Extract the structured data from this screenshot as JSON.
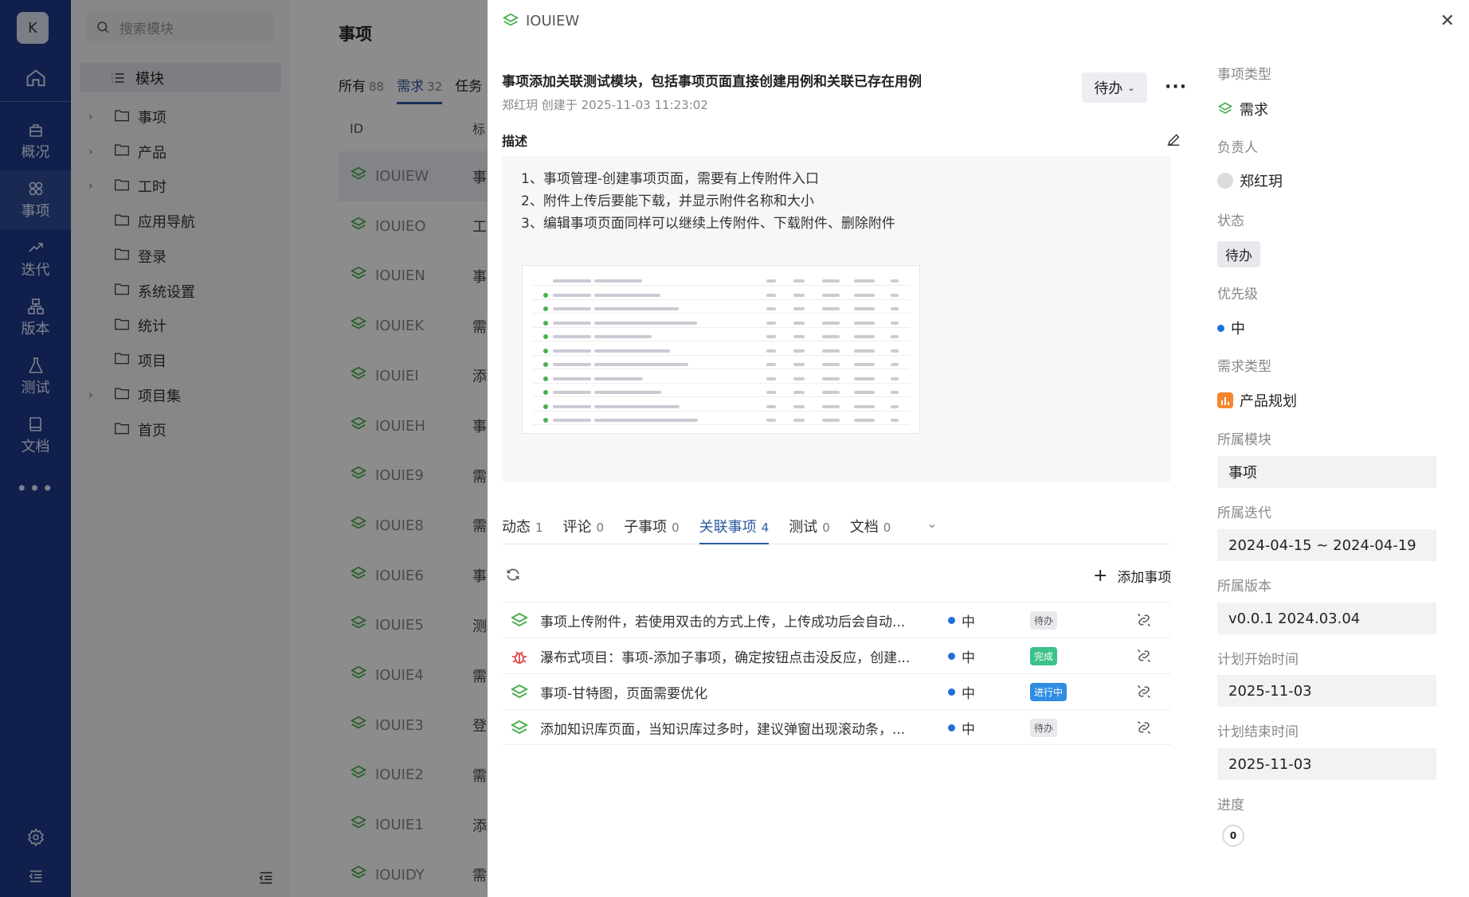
{
  "rail": {
    "avatar": "K",
    "items": [
      {
        "label": "概况",
        "icon": "overview-icon"
      },
      {
        "label": "事项",
        "icon": "workitem-icon"
      },
      {
        "label": "迭代",
        "icon": "sprint-icon"
      },
      {
        "label": "版本",
        "icon": "version-icon"
      },
      {
        "label": "测试",
        "icon": "test-icon"
      },
      {
        "label": "文档",
        "icon": "doc-icon"
      }
    ],
    "more": "•••"
  },
  "modules": {
    "search_placeholder": "搜索模块",
    "header": "模块",
    "tree": [
      {
        "label": "事项",
        "expandable": true
      },
      {
        "label": "产品",
        "expandable": true
      },
      {
        "label": "工时",
        "expandable": true
      },
      {
        "label": "应用导航",
        "expandable": false
      },
      {
        "label": "登录",
        "expandable": false
      },
      {
        "label": "系统设置",
        "expandable": false
      },
      {
        "label": "统计",
        "expandable": false
      },
      {
        "label": "项目",
        "expandable": false
      },
      {
        "label": "项目集",
        "expandable": true
      },
      {
        "label": "首页",
        "expandable": false
      }
    ]
  },
  "list": {
    "title": "事项",
    "tabs": [
      {
        "label": "所有",
        "count": "88"
      },
      {
        "label": "需求",
        "count": "32"
      },
      {
        "label": "任务",
        "count": ""
      }
    ],
    "columns": {
      "id": "ID",
      "title": "标"
    },
    "rows": [
      {
        "id": "IOUIEW",
        "t": "事"
      },
      {
        "id": "IOUIEO",
        "t": "工"
      },
      {
        "id": "IOUIEN",
        "t": "事"
      },
      {
        "id": "IOUIEK",
        "t": "需"
      },
      {
        "id": "IOUIEI",
        "t": "添"
      },
      {
        "id": "IOUIEH",
        "t": "事"
      },
      {
        "id": "IOUIE9",
        "t": "需"
      },
      {
        "id": "IOUIE8",
        "t": "需"
      },
      {
        "id": "IOUIE6",
        "t": "事"
      },
      {
        "id": "IOUIE5",
        "t": "测"
      },
      {
        "id": "IOUIE4",
        "t": "需"
      },
      {
        "id": "IOUIE3",
        "t": "登"
      },
      {
        "id": "IOUIE2",
        "t": "需"
      },
      {
        "id": "IOUIE1",
        "t": "添"
      },
      {
        "id": "IOUIDY",
        "t": "需"
      }
    ]
  },
  "drawer": {
    "item_id": "IOUIEW",
    "title": "事项添加关联测试模块，包括事项页面直接创建用例和关联已存在用例",
    "meta": "郑红玥 创建于 2025-11-03 11:23:02",
    "status": "待办",
    "description_label": "描述",
    "description_lines": [
      "1、事项管理-创建事项页面，需要有上传附件入口",
      "2、附件上传后要能下载，并显示附件名称和大小",
      "3、编辑事项页面同样可以继续上传附件、下载附件、删除附件"
    ],
    "tabs": [
      {
        "label": "动态",
        "count": "1"
      },
      {
        "label": "评论",
        "count": "0"
      },
      {
        "label": "子事项",
        "count": "0"
      },
      {
        "label": "关联事项",
        "count": "4"
      },
      {
        "label": "测试",
        "count": "0"
      },
      {
        "label": "文档",
        "count": "0"
      }
    ],
    "add_item": "添加事项",
    "related": [
      {
        "icon": "requirement-icon",
        "title": "事项上传附件，若使用双击的方式上传，上传成功后会自动...",
        "priority": "中",
        "status": "待办",
        "status_color": "#e8e9ec"
      },
      {
        "icon": "bug-icon",
        "title": "瀑布式项目：事项-添加子事项，确定按钮点击没反应，创建...",
        "priority": "中",
        "status": "完成",
        "status_color": "#3cc28a"
      },
      {
        "icon": "requirement-icon",
        "title": "事项-甘特图，页面需要优化",
        "priority": "中",
        "status": "进行中",
        "status_color": "#2f8de4"
      },
      {
        "icon": "requirement-icon",
        "title": "添加知识库页面，当知识库过多时，建议弹窗出现滚动条，...",
        "priority": "中",
        "status": "待办",
        "status_color": "#e8e9ec"
      }
    ]
  },
  "props": {
    "type_label": "事项类型",
    "type": "需求",
    "owner_label": "负责人",
    "owner": "郑红玥",
    "status_label": "状态",
    "status": "待办",
    "priority_label": "优先级",
    "priority": "中",
    "req_type_label": "需求类型",
    "req_type": "产品规划",
    "module_label": "所属模块",
    "module": "事项",
    "sprint_label": "所属迭代",
    "sprint": "2024-04-15 ~ 2024-04-19",
    "version_label": "所属版本",
    "version": "v0.0.1 2024.03.04",
    "start_label": "计划开始时间",
    "start": "2025-11-03",
    "end_label": "计划结束时间",
    "end": "2025-11-03",
    "progress_label": "进度",
    "progress": "0"
  }
}
